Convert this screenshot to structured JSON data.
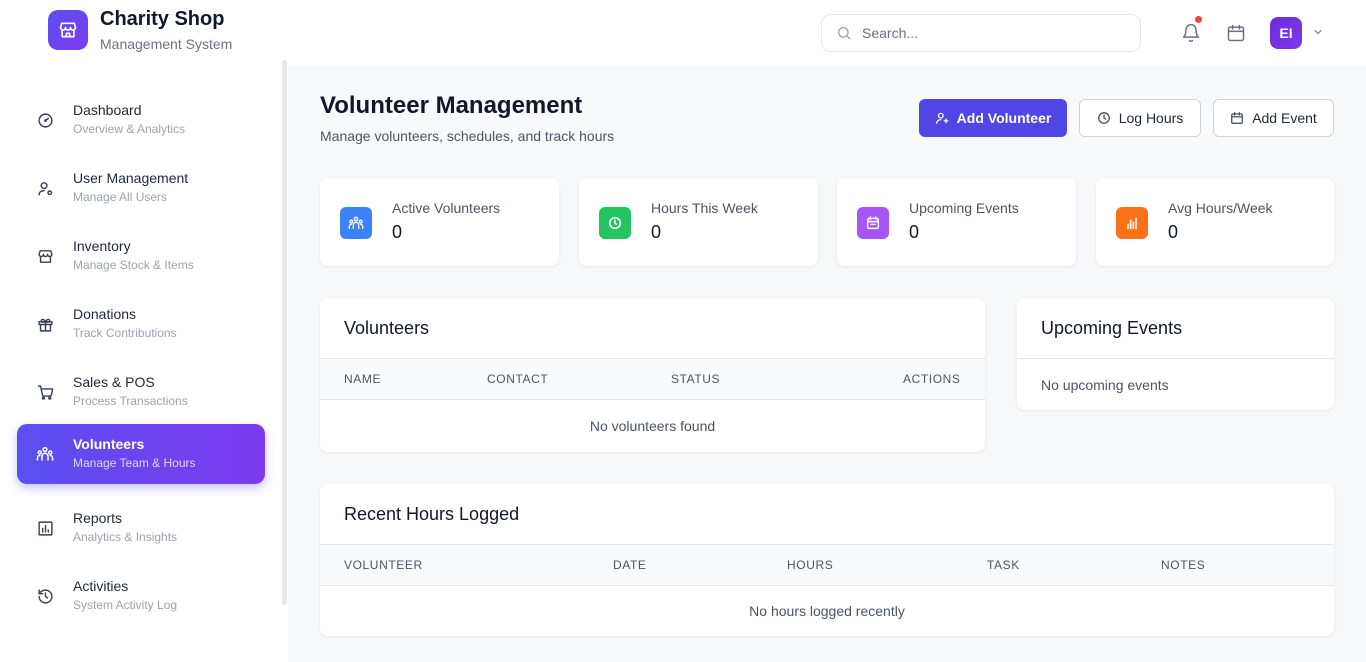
{
  "brand": {
    "title": "Charity Shop",
    "subtitle": "Management System"
  },
  "search": {
    "placeholder": "Search..."
  },
  "user": {
    "initials": "EI"
  },
  "sidebar": {
    "items": [
      {
        "label": "Dashboard",
        "sub": "Overview & Analytics",
        "icon": "gauge-icon"
      },
      {
        "label": "User Management",
        "sub": "Manage All Users",
        "icon": "user-gear-icon"
      },
      {
        "label": "Inventory",
        "sub": "Manage Stock & Items",
        "icon": "store-icon"
      },
      {
        "label": "Donations",
        "sub": "Track Contributions",
        "icon": "gift-icon"
      },
      {
        "label": "Sales & POS",
        "sub": "Process Transactions",
        "icon": "cart-icon"
      },
      {
        "label": "Volunteers",
        "sub": "Manage Team & Hours",
        "icon": "people-icon",
        "active": true
      },
      {
        "label": "Reports",
        "sub": "Analytics & Insights",
        "icon": "chart-icon"
      },
      {
        "label": "Activities",
        "sub": "System Activity Log",
        "icon": "history-icon"
      }
    ]
  },
  "page": {
    "title": "Volunteer Management",
    "subtitle": "Manage volunteers, schedules, and track hours"
  },
  "actions": {
    "add_volunteer": "Add Volunteer",
    "log_hours": "Log Hours",
    "add_event": "Add Event"
  },
  "stats": [
    {
      "label": "Active Volunteers",
      "value": "0",
      "color": "#3b82f6",
      "icon": "people-icon"
    },
    {
      "label": "Hours This Week",
      "value": "0",
      "color": "#22c55e",
      "icon": "clock-icon"
    },
    {
      "label": "Upcoming Events",
      "value": "0",
      "color": "#a855f7",
      "icon": "calendar-icon"
    },
    {
      "label": "Avg Hours/Week",
      "value": "0",
      "color": "#f97316",
      "icon": "bar-chart-icon"
    }
  ],
  "volunteers_table": {
    "title": "Volunteers",
    "columns": [
      "NAME",
      "CONTACT",
      "STATUS",
      "ACTIONS"
    ],
    "empty": "No volunteers found"
  },
  "events_panel": {
    "title": "Upcoming Events",
    "empty": "No upcoming events"
  },
  "hours_table": {
    "title": "Recent Hours Logged",
    "columns": [
      "VOLUNTEER",
      "DATE",
      "HOURS",
      "TASK",
      "NOTES"
    ],
    "empty": "No hours logged recently"
  }
}
